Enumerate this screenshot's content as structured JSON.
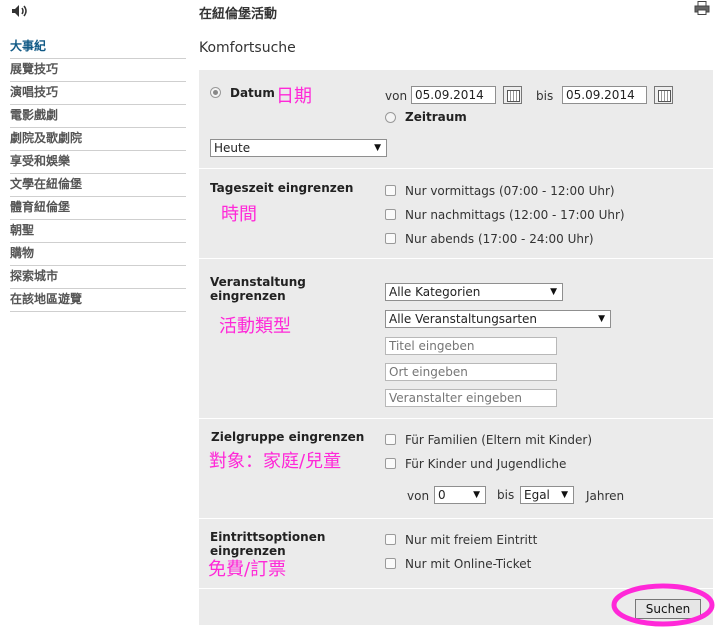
{
  "header": {
    "title": "在紐倫堡活動",
    "speaker_icon": "speaker-icon",
    "print_icon": "print-icon"
  },
  "sidebar": {
    "items": [
      {
        "label": "大事紀",
        "active": true
      },
      {
        "label": "展覽技巧"
      },
      {
        "label": "演唱技巧"
      },
      {
        "label": "電影戲劇"
      },
      {
        "label": "劇院及歌劇院"
      },
      {
        "label": "享受和娛樂"
      },
      {
        "label": "文學在紐倫堡"
      },
      {
        "label": "體育紐倫堡"
      },
      {
        "label": "朝聖"
      },
      {
        "label": "購物"
      },
      {
        "label": "探索城市"
      },
      {
        "label": "在該地區遊覽"
      }
    ]
  },
  "form": {
    "title": "Komfortsuche",
    "datum_label": "Datum",
    "datum_note": "日期",
    "von_label": "von",
    "von_value": "05.09.2014",
    "bis_label": "bis",
    "bis_value": "05.09.2014",
    "zeitraum_label": "Zeitraum",
    "period_select": "Heute",
    "tageszeit_label": "Tageszeit eingrenzen",
    "tageszeit_note": "時間",
    "tageszeit_options": [
      "Nur vormittags (07:00 - 12:00 Uhr)",
      "Nur nachmittags (12:00 - 17:00 Uhr)",
      "Nur abends (17:00 - 24:00 Uhr)"
    ],
    "veranstaltung_label_1": "Veranstaltung",
    "veranstaltung_label_2": "eingrenzen",
    "veranstaltung_note": "活動類型",
    "kategorie_select": "Alle Kategorien",
    "art_select": "Alle Veranstaltungsarten",
    "titel_placeholder": "Titel eingeben",
    "ort_placeholder": "Ort eingeben",
    "veranstalter_placeholder": "Veranstalter eingeben",
    "zielgruppe_label": "Zielgruppe eingrenzen",
    "zielgruppe_note": "對象：家庭/兒童",
    "zielgruppe_options": [
      "Für Familien (Eltern mit Kinder)",
      "Für Kinder und Jugendliche"
    ],
    "alter_von_label": "von",
    "alter_von_value": "0",
    "alter_bis_label": "bis",
    "alter_bis_value": "Egal",
    "jahren_label": "Jahren",
    "eintritt_label_1": "Eintrittsoptionen",
    "eintritt_label_2": "eingrenzen",
    "eintritt_note": "免費/訂票",
    "eintritt_options": [
      "Nur mit freiem Eintritt",
      "Nur mit Online-Ticket"
    ],
    "submit_label": "Suchen"
  },
  "colors": {
    "accent_pink": "#ff28d8",
    "panel_bg": "#ebebeb",
    "active_link": "#115a86"
  }
}
